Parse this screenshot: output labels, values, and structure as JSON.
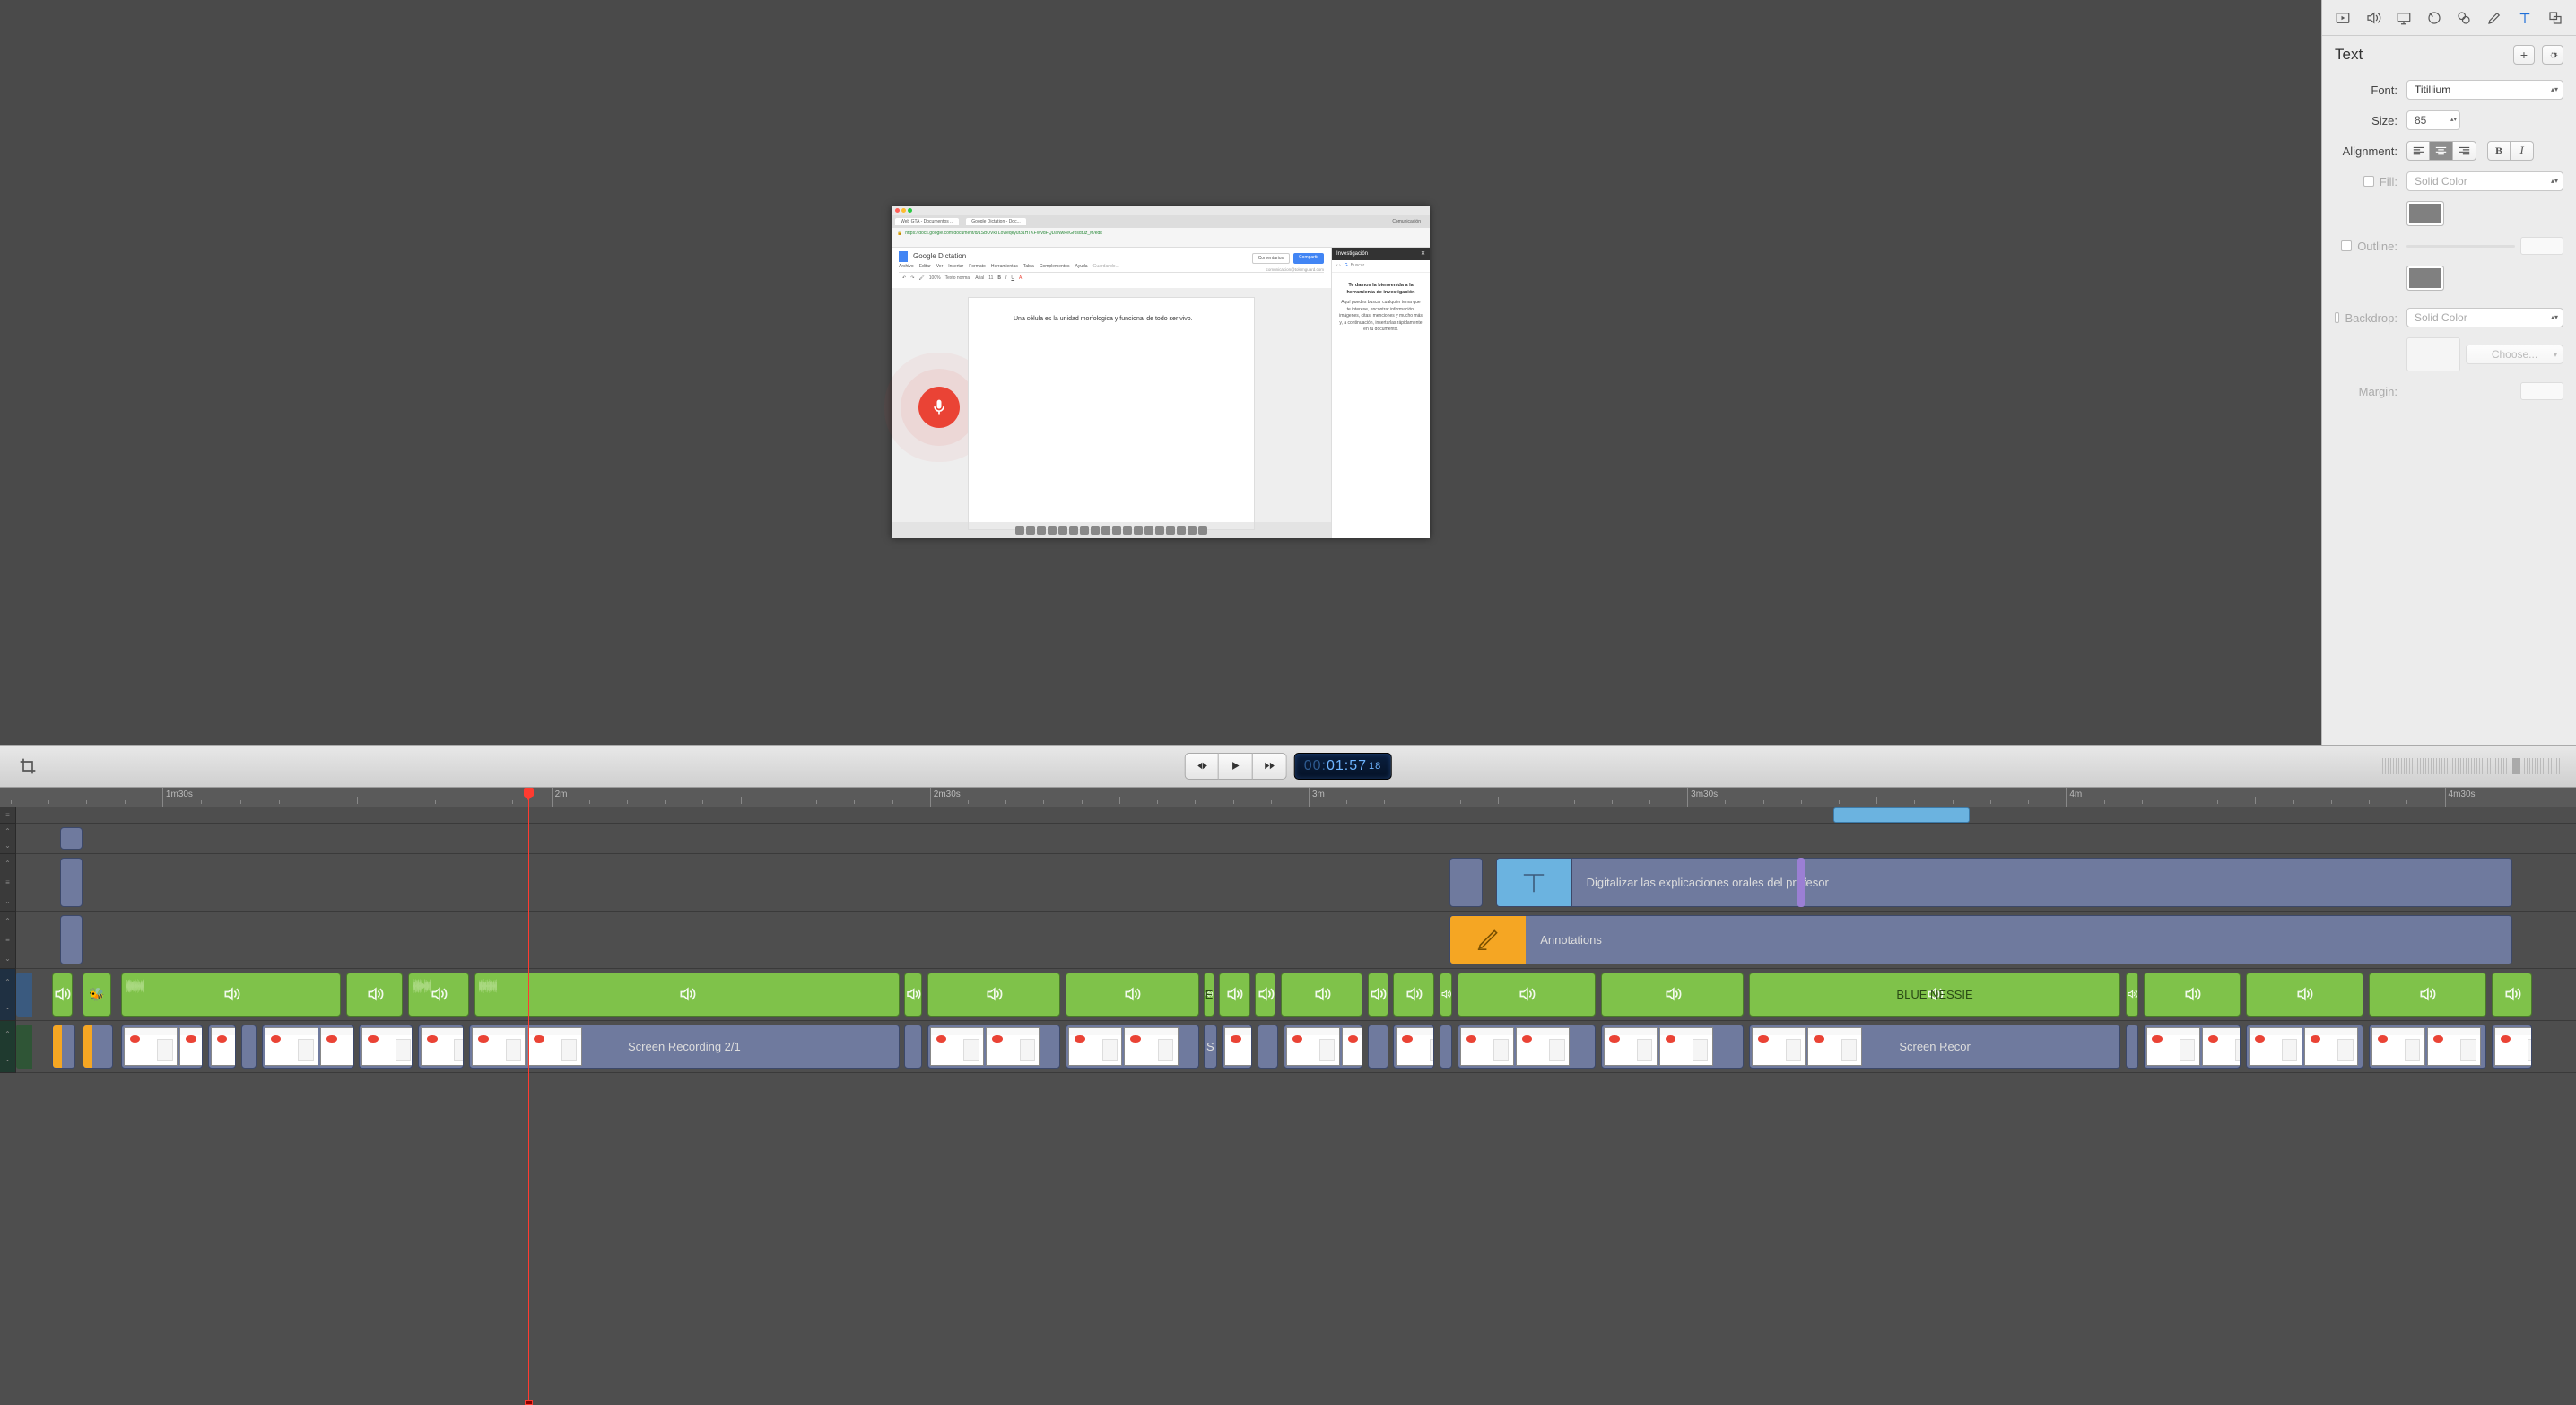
{
  "inspector": {
    "title": "Text",
    "add_label": "+",
    "font_label": "Font:",
    "font_value": "Titillium",
    "size_label": "Size:",
    "size_value": "85",
    "align_label": "Alignment:",
    "fill_label": "Fill:",
    "fill_value": "Solid Color",
    "outline_label": "Outline:",
    "backdrop_label": "Backdrop:",
    "backdrop_value": "Solid Color",
    "choose_label": "Choose...",
    "margin_label": "Margin:"
  },
  "transport": {
    "timecode_prefix": "00:",
    "timecode_main": "01:57",
    "timecode_frames": "18"
  },
  "ruler": {
    "marks": [
      "1m30s",
      "2m",
      "2m30s",
      "3m",
      "3m30s",
      "4m",
      "4m30s"
    ]
  },
  "tracks": {
    "text_clip_label": "Digitalizar las explicaciones orales del profesor",
    "anno_clip_label": "Annotations",
    "audio_label": "BLUE NESSIE",
    "audio_cut_label": "E",
    "video_label_1": "Screen Recording 2/1",
    "video_label_2": "S",
    "video_label_3": "Screen Recor"
  },
  "preview": {
    "tab1": "Web GTA - Documentos ...",
    "tab2": "Google Dictation - Doc...",
    "url": "https://docs.google.com/document/d/1SBUVkTLovieqeyuf31HTKFWvdFQDaNwFeGrosdtuz_M/edit",
    "comunicacion": "Comunicación",
    "doc_title": "Google Dictation",
    "menus": [
      "Archivo",
      "Editar",
      "Ver",
      "Insertar",
      "Formato",
      "Herramientas",
      "Tabla",
      "Complementos",
      "Ayuda",
      "Guardando..."
    ],
    "toolbar_items": [
      "100%",
      "Texto normal",
      "Arial",
      "11"
    ],
    "comment_btn": "Comentarios",
    "share_btn": "Compartir",
    "account": "comunicacion@tolemguard.com",
    "body_text": "Una célula es la unidad morfologica y funcional de todo ser vivo.",
    "side_title": "Investigación",
    "side_search": "Buscar",
    "side_welcome": "Te damos la bienvenida a la herramienta de investigación",
    "side_body": "Aquí puedes buscar cualquier tema que te interese, encontrar información, imágenes, citas, menciones y mucho más y, a continuación, insertarlas rápidamente en tu documento."
  }
}
